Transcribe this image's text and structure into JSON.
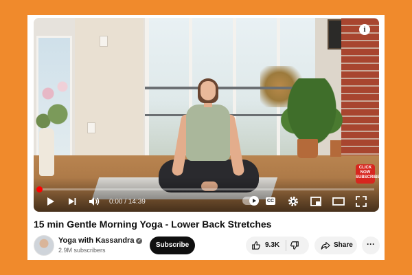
{
  "video": {
    "current_time": "0:00",
    "duration": "14:39",
    "time_display": "0:00 / 14:39",
    "progress_fraction": 0.0,
    "badge_text": "CLICK NOW SUBSCRIBE",
    "info_label": "i",
    "cc_label": "CC"
  },
  "details": {
    "title": "15 min Gentle Morning Yoga - Lower Back Stretches",
    "channel_name": "Yoga with Kassandra",
    "subscribers": "2.9M subscribers",
    "subscribe_label": "Subscribe",
    "like_count": "9.3K",
    "share_label": "Share",
    "more_label": "···"
  },
  "colors": {
    "background": "#F08A2C",
    "progress": "#FF0000",
    "subscribe_button": "#0F0F0F"
  },
  "icons": {
    "controls": [
      "play-icon",
      "next-icon",
      "volume-icon",
      "autoplay-toggle",
      "cc-icon",
      "settings-icon",
      "miniplayer-icon",
      "theater-icon",
      "fullscreen-icon"
    ],
    "actions": [
      "thumbs-up-icon",
      "thumbs-down-icon",
      "share-icon",
      "more-icon",
      "verified-icon",
      "info-icon"
    ]
  }
}
